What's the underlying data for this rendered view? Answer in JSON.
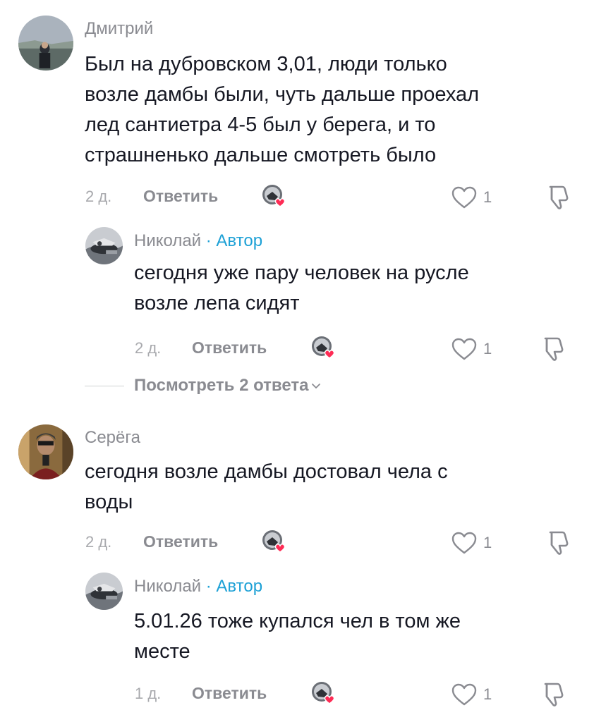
{
  "comments": [
    {
      "username": "Дмитрий",
      "text_lines": [
        "Был на дубровском 3,01, люди только",
        "возле дамбы были, чуть дальше проехал",
        "лед сантиетра 4-5 был у берега, и то",
        "страшненько дальше смотреть было"
      ],
      "time": "2 д.",
      "reply_label": "Ответить",
      "likes": "1"
    },
    {
      "username": "Николай",
      "author_tag": "· Автор",
      "text_lines": [
        "сегодня уже пару человек на русле",
        "возле лепа сидят"
      ],
      "time": "2 д.",
      "reply_label": "Ответить",
      "likes": "1"
    },
    {
      "username": "Серёга",
      "text_lines": [
        "сегодня возле дамбы достовал чела с",
        "воды"
      ],
      "time": "2 д.",
      "reply_label": "Ответить",
      "likes": "1"
    },
    {
      "username": "Николай",
      "author_tag": "· Автор",
      "text_lines": [
        "5.01.26 тоже купался чел в том же",
        "месте"
      ],
      "time": "1 д.",
      "reply_label": "Ответить",
      "likes": "1"
    }
  ],
  "view_replies": {
    "label": "Посмотреть 2 ответа",
    "icon": "chevron-down-icon"
  },
  "colors": {
    "author": "#1ea1d6",
    "heart_badge": "#fe2c55",
    "muted": "#8a8b91"
  }
}
